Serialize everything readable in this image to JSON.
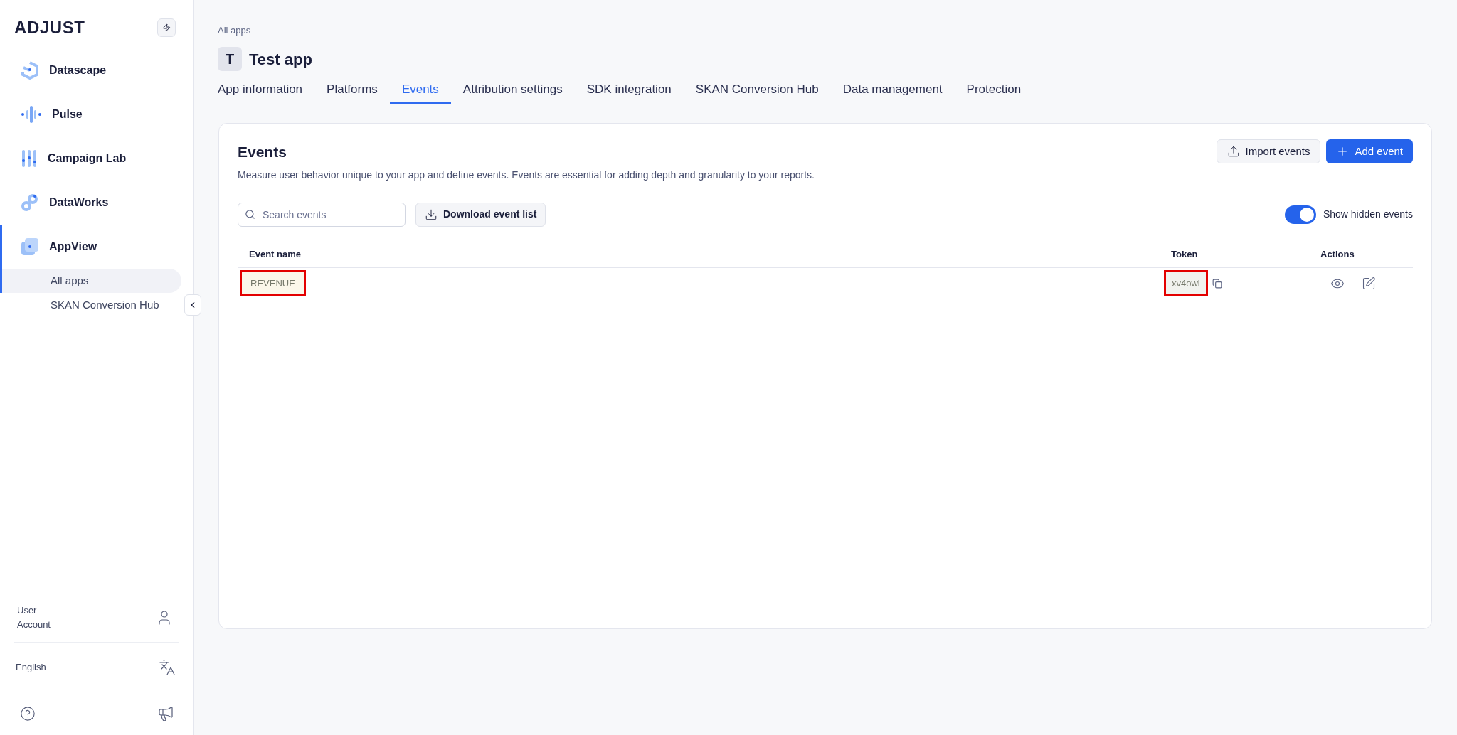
{
  "sidebar": {
    "logo": "ADJUST",
    "items": [
      {
        "kind": "datascape",
        "label": "Datascape",
        "selected": false
      },
      {
        "kind": "pulse",
        "label": "Pulse",
        "selected": false
      },
      {
        "kind": "campaign",
        "label": "Campaign Lab",
        "selected": false
      },
      {
        "kind": "dataworks",
        "label": "DataWorks",
        "selected": false
      },
      {
        "kind": "appview",
        "label": "AppView",
        "selected": true,
        "children": [
          {
            "label": "All apps",
            "selected": true
          },
          {
            "label": "SKAN Conversion Hub",
            "selected": false
          }
        ]
      }
    ],
    "account": [
      "User",
      "Account"
    ],
    "language": "English"
  },
  "breadcrumb": "All apps",
  "app": {
    "initial": "T",
    "name": "Test app"
  },
  "tabs": [
    {
      "label": "App information",
      "selected": false
    },
    {
      "label": "Platforms",
      "selected": false
    },
    {
      "label": "Events",
      "selected": true
    },
    {
      "label": "Attribution settings",
      "selected": false
    },
    {
      "label": "SDK integration",
      "selected": false
    },
    {
      "label": "SKAN Conversion Hub",
      "selected": false
    },
    {
      "label": "Data management",
      "selected": false
    },
    {
      "label": "Protection",
      "selected": false
    }
  ],
  "panel": {
    "title": "Events",
    "description": "Measure user behavior unique to your app and define events. Events are essential for adding depth and granularity to your reports.",
    "import_button": "Import events",
    "add_button": "Add event",
    "search": {
      "placeholder": "Search events"
    },
    "download_button": "Download event list",
    "toggle": {
      "label": "Show hidden events",
      "on": true
    }
  },
  "table": {
    "columns": [
      "Event name",
      "Token",
      "Actions"
    ],
    "rows": [
      {
        "name": "REVENUE",
        "token": "xv4owl",
        "highlighted": true
      }
    ]
  }
}
